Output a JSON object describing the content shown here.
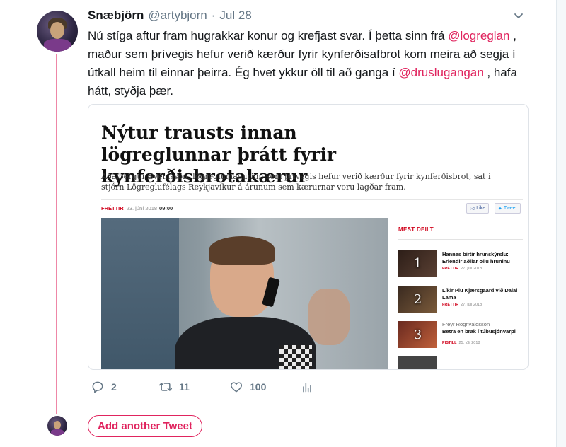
{
  "tweet": {
    "name": "Snæbjörn",
    "handle": "@artybjorn",
    "separator": "·",
    "date": "Jul 28",
    "text_segments": [
      {
        "text": "Nú stíga aftur fram hugrakkar konur og krefjast svar. Í þetta sinn frá ",
        "type": "plain"
      },
      {
        "text": "@logreglan",
        "type": "mention"
      },
      {
        "text": " , maður sem þrívegis hefur verið kærður fyrir kynferðisafbrot kom meira að segja í útkall heim til einnar þeirra. Ég hvet ykkur öll til að ganga í ",
        "type": "plain"
      },
      {
        "text": "@druslugangan",
        "type": "mention"
      },
      {
        "text": " , hafa hátt, styðja þær.",
        "type": "plain"
      }
    ]
  },
  "article": {
    "title": "Nýtur trausts innan lögreglunnar þrátt fyrir kynferðisbrotakærur",
    "lead": "Aðalbergur Sveinsson, lögreglumaðurinn sem þrívegis hefur verið kærður fyrir kynferðisbrot, sat í stjórn Lögreglufélags Reykjavíkur á árunum sem kærurnar voru lagðar fram.",
    "category": "FRÉTTIR",
    "date": "23. júní 2018",
    "time": "09:00",
    "like_label": "Like",
    "tweet_label": "Tweet",
    "sidebar": {
      "title": "MEST DEILT",
      "items": [
        {
          "number": "1",
          "author": "",
          "headline": "Hannes birtir hrunskýrslu: Erlendir aðilar ollu hruninu",
          "category": "FRÉTTIR",
          "date": "27. júlí 2018"
        },
        {
          "number": "2",
          "author": "",
          "headline": "Líkir Piu Kjærsgaard við Dalai Lama",
          "category": "FRÉTTIR",
          "date": "27. júlí 2018"
        },
        {
          "number": "3",
          "author": "Freyr Rögnvaldsson",
          "headline": "Betra en brak í túbusjónvarpi",
          "category": "PISTILL",
          "date": "25. júlí 2018"
        }
      ]
    }
  },
  "actions": {
    "reply_count": "2",
    "retweet_count": "11",
    "like_count": "100"
  },
  "add_tweet_label": "Add another Tweet",
  "colors": {
    "accent": "#e0245e",
    "text": "#14171a",
    "muted": "#657786",
    "news_red": "#d0021b"
  },
  "icons": [
    "reply-icon",
    "retweet-icon",
    "like-icon",
    "analytics-icon",
    "chevron-down-icon"
  ]
}
